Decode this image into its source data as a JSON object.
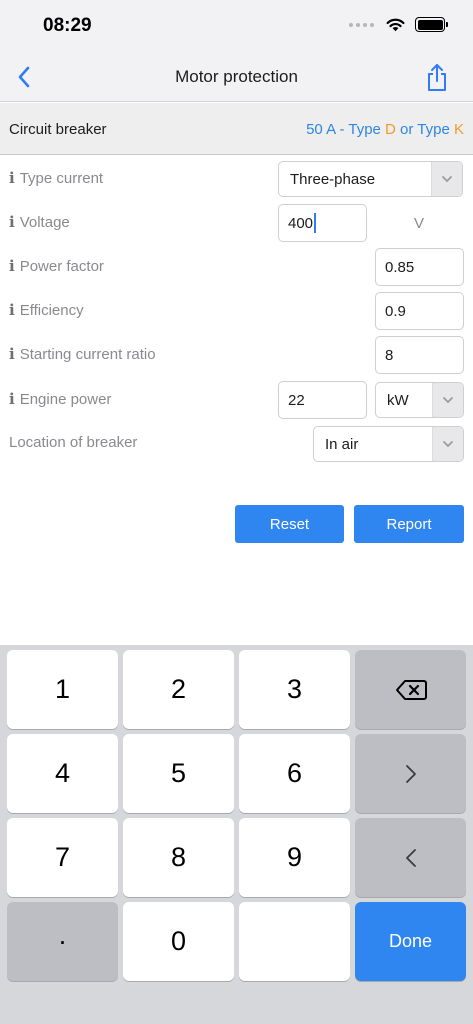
{
  "status_bar": {
    "time": "08:29"
  },
  "nav": {
    "title": "Motor protection",
    "back_icon": "chevron-left-icon",
    "share_icon": "share-icon"
  },
  "result": {
    "label": "Circuit breaker",
    "value_prefix": "50 A - Type ",
    "type_d": "D",
    "middle": " or Type ",
    "type_k": "K"
  },
  "form": {
    "type_current": {
      "label": "Type current",
      "value": "Three-phase"
    },
    "voltage": {
      "label": "Voltage",
      "value": "400",
      "unit": "V"
    },
    "power_factor": {
      "label": "Power factor",
      "value": "0.85"
    },
    "efficiency": {
      "label": "Efficiency",
      "value": "0.9"
    },
    "starting_current_ratio": {
      "label": "Starting current ratio",
      "value": "8"
    },
    "engine_power": {
      "label": "Engine power",
      "value": "22",
      "unit": "kW"
    },
    "location": {
      "label": "Location of breaker",
      "value": "In air"
    }
  },
  "buttons": {
    "reset": "Reset",
    "report": "Report"
  },
  "keyboard": {
    "k1": "1",
    "k2": "2",
    "k3": "3",
    "k4": "4",
    "k5": "5",
    "k6": "6",
    "k7": "7",
    "k8": "8",
    "k9": "9",
    "dot": "·",
    "k0": "0",
    "done": "Done"
  },
  "colors": {
    "accent": "#2f86f0",
    "orange": "#f39a2b"
  }
}
